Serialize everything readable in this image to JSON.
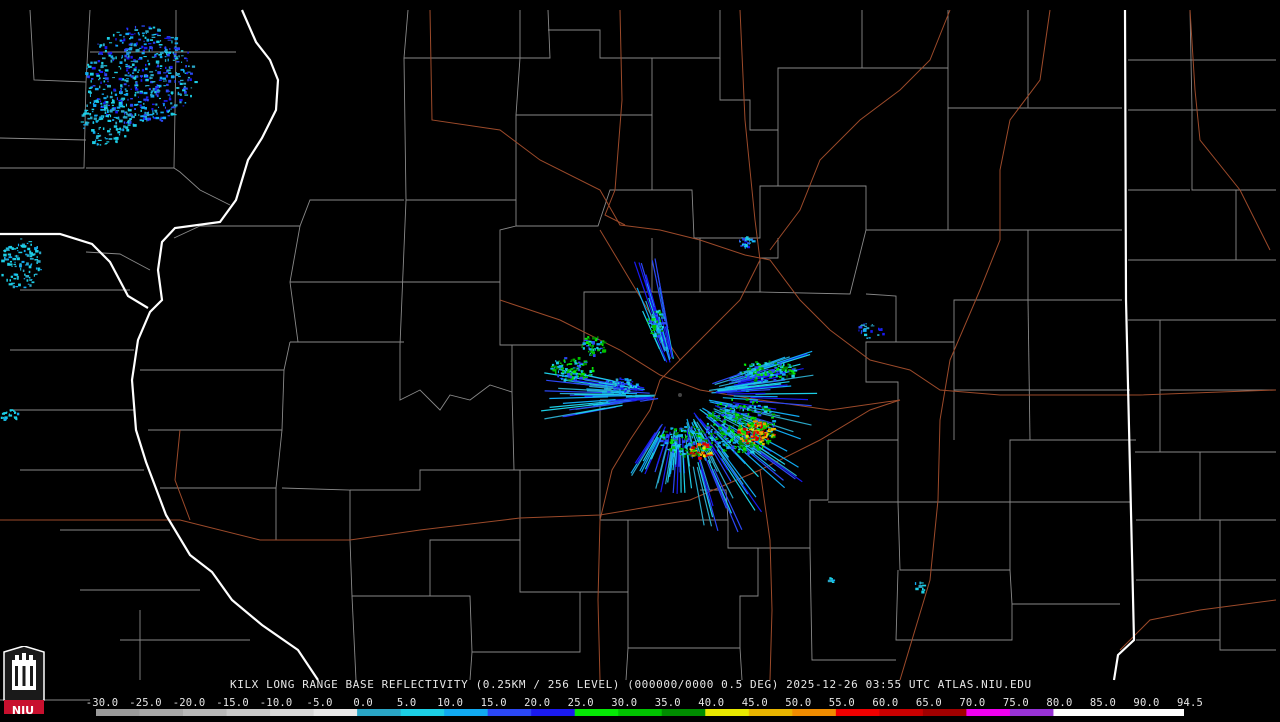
{
  "header": {
    "title": "KILX LONG RANGE BASE REFLECTIVITY (0.25KM / 256 LEVEL) (000000/0000 0.5 DEG) 2025-12-26 03:55 UTC  ATLAS.NIU.EDU"
  },
  "logo": {
    "text": "NIU"
  },
  "colorbar": {
    "tick_labels": [
      "-30.0",
      "-25.0",
      "-20.0",
      "-15.0",
      "-10.0",
      "-5.0",
      "0.0",
      "5.0",
      "10.0",
      "15.0",
      "20.0",
      "25.0",
      "30.0",
      "35.0",
      "40.0",
      "45.0",
      "50.0",
      "55.0",
      "60.0",
      "65.0",
      "70.0",
      "75.0",
      "80.0",
      "85.0",
      "90.0",
      "94.5"
    ],
    "colors": [
      "#9a9a9a",
      "#a8a8a8",
      "#b8b8b8",
      "#c8c8c8",
      "#d8d8d8",
      "#e8e8e8",
      "#2aa6c6",
      "#1ccfe6",
      "#11aaf2",
      "#2b48f5",
      "#1a1af0",
      "#05e805",
      "#00c200",
      "#008c00",
      "#e8e800",
      "#e8b400",
      "#f08c00",
      "#f00000",
      "#c80000",
      "#a00000",
      "#f000f0",
      "#9832d6",
      "#ffffff",
      "#ffffff",
      "#ffffff"
    ]
  },
  "map": {
    "state_line_color": "#ffffff",
    "county_line_color": "#888888",
    "highway_color": "#9c4a2a"
  }
}
